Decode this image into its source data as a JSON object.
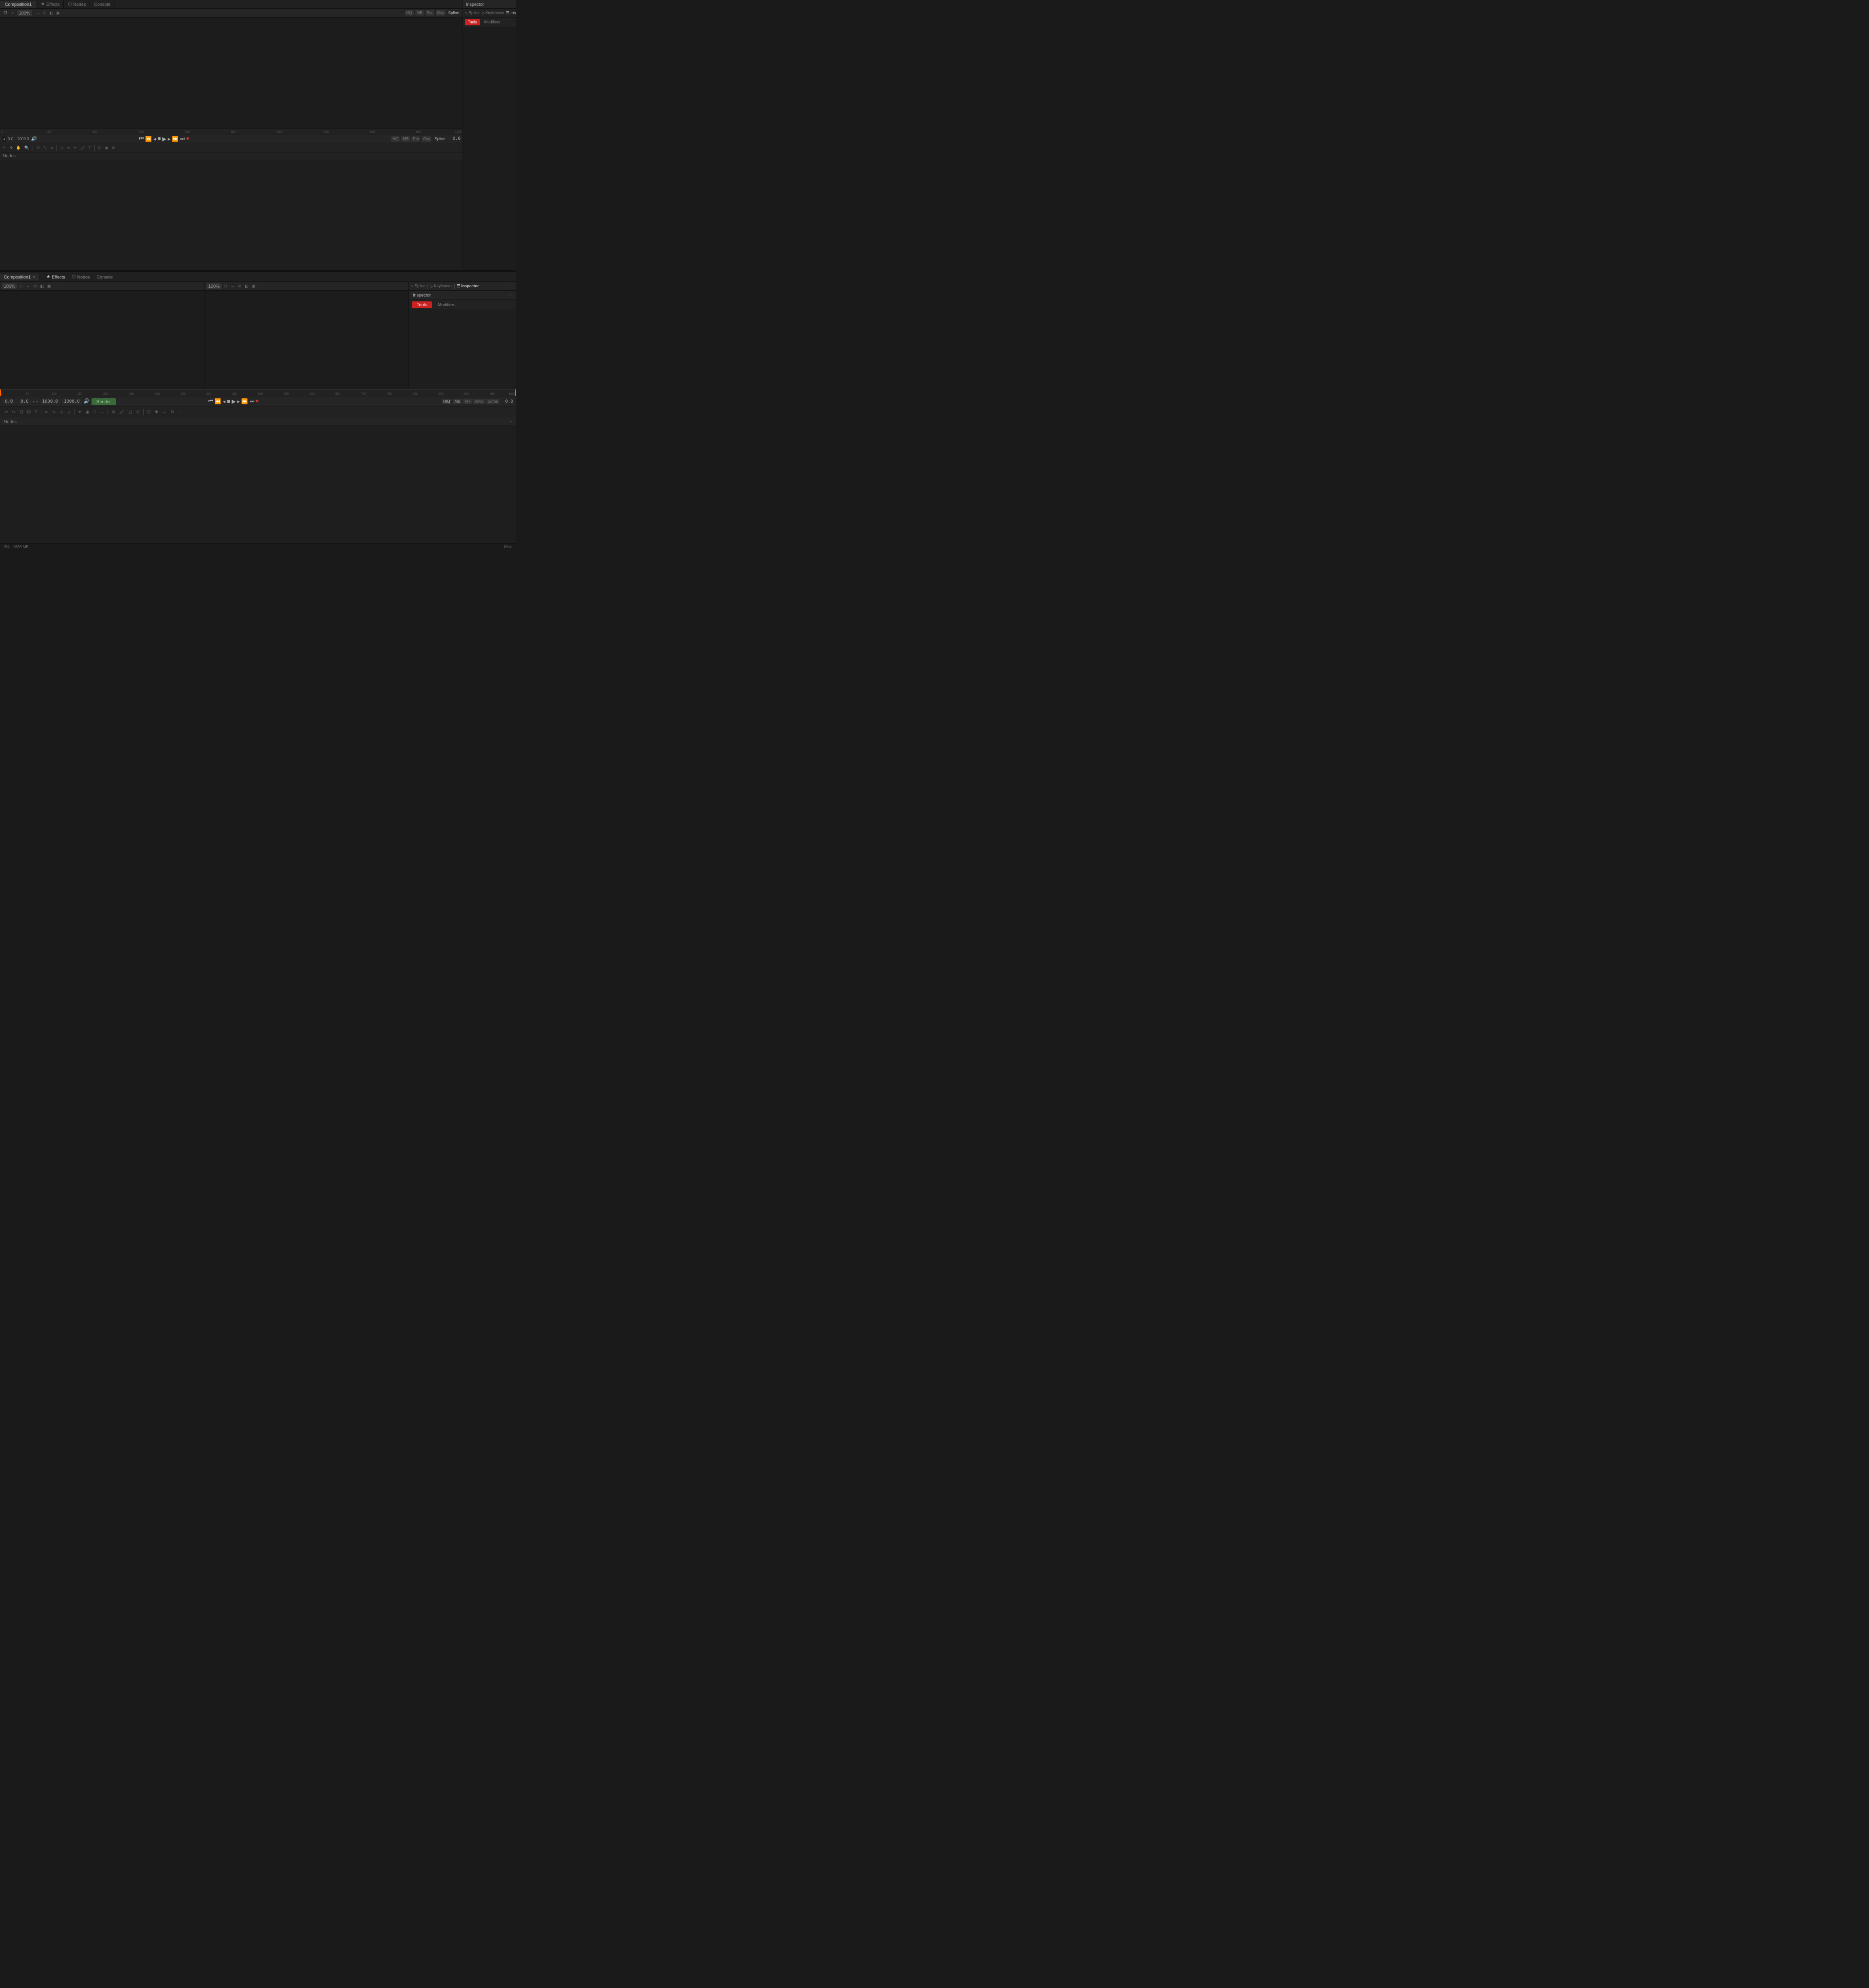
{
  "app": {
    "title": "Composition1"
  },
  "top_tabs": [
    {
      "label": "Effects",
      "active": true,
      "closable": false
    },
    {
      "label": "Nodes",
      "active": false,
      "closable": false
    }
  ],
  "viewer_top": {
    "zoom": "100%",
    "toolbar_items": [
      "fit",
      "zoom_in",
      "zoom_out",
      "split",
      "grid",
      "channels",
      "lut"
    ],
    "right_items": [
      "HQ",
      "MB",
      "Prx",
      "Oxy",
      "Spline"
    ]
  },
  "playback": {
    "current_frame": "0.0",
    "start_frame": "0.0",
    "end_frame": "1000.0",
    "duration": "1000.0",
    "current_time": "0.0"
  },
  "top_right_panel": {
    "title": "Inspector",
    "tabs": [
      {
        "label": "Spline",
        "active": false
      },
      {
        "label": "Keyframes",
        "active": false
      },
      {
        "label": "Inspector",
        "active": true
      }
    ]
  },
  "bottom_section": {
    "comp_tab": "Composition1",
    "close_icon": "×",
    "tabs": [
      {
        "label": "Effects",
        "active": true,
        "icon": "★"
      },
      {
        "label": "Nodes",
        "active": false,
        "icon": "⬡"
      },
      {
        "label": "Console",
        "active": false,
        "icon": ""
      }
    ]
  },
  "bottom_left_viewer": {
    "zoom": "100%"
  },
  "bottom_right_viewer": {
    "zoom": "100%"
  },
  "bottom_playback": {
    "current_frame": "0.0",
    "start_frame": "0.0",
    "end_frame": "1000.0",
    "duration": "1000.0",
    "current_time": "0.0",
    "render_label": "Render",
    "quality": "HiQ",
    "mb": "MB",
    "prx": "Prx",
    "aprx": "APrx",
    "some": "Some"
  },
  "inspector": {
    "title": "Inspector",
    "tools_label": "Tools",
    "modifiers_label": "Modifiers"
  },
  "nodes_area": {
    "label": "Nodes"
  },
  "status_bar": {
    "memory": "3% · 1683 MB",
    "info": "Misc"
  },
  "ruler_marks": [
    "0",
    "50",
    "100",
    "150",
    "200",
    "250",
    "300",
    "350",
    "400",
    "450",
    "500",
    "550",
    "600",
    "650",
    "700",
    "750",
    "800",
    "850",
    "900",
    "950",
    "1000"
  ],
  "bottom_ruler_marks": [
    "0",
    "50",
    "100",
    "150",
    "200",
    "250",
    "300",
    "350",
    "400",
    "450",
    "500",
    "550",
    "600",
    "650",
    "700",
    "750",
    "800",
    "850",
    "900",
    "950",
    "1000"
  ],
  "icons": {
    "effects": "★",
    "nodes": "⬡",
    "console": "≡",
    "spline": "∿",
    "keyframes": "◇",
    "inspector": "☰",
    "play": "▶",
    "pause": "⏸",
    "stop": "■",
    "prev": "⏮",
    "next": "⏭",
    "rewind": "⏪",
    "forward": "⏩",
    "loop": "↺",
    "record": "⏺",
    "close": "×",
    "chevron": "▾",
    "more": "···",
    "fit": "⊡",
    "zoom_in": "+",
    "zoom_out": "−",
    "grid": "⊞",
    "speaker": "🔊"
  }
}
